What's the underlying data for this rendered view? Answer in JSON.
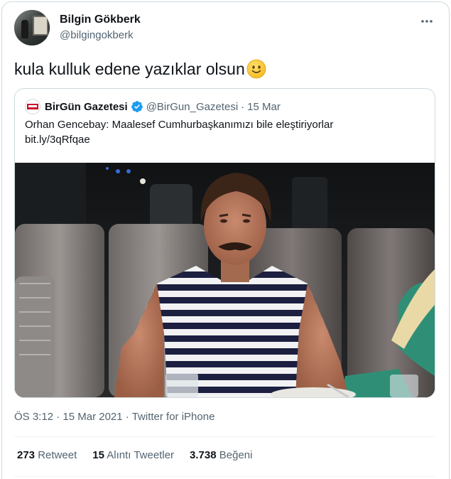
{
  "tweet": {
    "author": {
      "display_name": "Bilgin Gökberk",
      "handle": "@bilgingokberk",
      "avatar": "profile-photo"
    },
    "text": "kula kulluk edene yazıklar olsun",
    "emoji": "slightly-smiling-face",
    "more_icon": "more-dots-icon",
    "quote": {
      "author_name": "BirGün Gazetesi",
      "verified": true,
      "handle": "@BirGun_Gazetesi",
      "separator": "·",
      "date": "15 Mar",
      "text_line1": "Orhan Gencebay: Maalesef Cumhurbaşkanımızı bile eleştiriyorlar",
      "text_line2": "bit.ly/3qRfqae",
      "photo": "restaurant-portrait-photo"
    },
    "meta": {
      "time": "ÖS 3:12",
      "sep1": "·",
      "date": "15 Mar 2021",
      "sep2": "·",
      "source": "Twitter for iPhone"
    },
    "stats": {
      "retweets_count": "273",
      "retweets_label": "Retweet",
      "quotes_count": "15",
      "quotes_label": "Alıntı Tweetler",
      "likes_count": "3.738",
      "likes_label": "Beğeni"
    }
  },
  "colors": {
    "text_primary": "#0f1419",
    "text_secondary": "#536471",
    "border": "#cfd9de",
    "verified_blue": "#1d9bf0",
    "brand_red": "#c8102e"
  }
}
